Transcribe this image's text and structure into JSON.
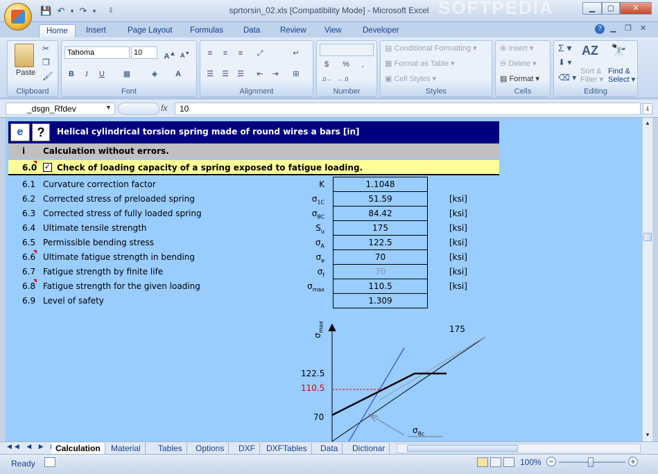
{
  "window": {
    "title": "sprtorsin_02.xls  [Compatibility Mode] - Microsoft Excel",
    "watermark": "SOFTPEDIA"
  },
  "tabs": [
    "Home",
    "Insert",
    "Page Layout",
    "Formulas",
    "Data",
    "Review",
    "View",
    "Developer"
  ],
  "ribbon": {
    "clipboard": {
      "label": "Clipboard",
      "paste": "Paste"
    },
    "font": {
      "label": "Font",
      "name": "Tahoma",
      "size": "10",
      "bold": "B",
      "italic": "I",
      "underline": "U"
    },
    "alignment": {
      "label": "Alignment"
    },
    "number": {
      "label": "Number",
      "currency": "$",
      "percent": "%",
      "comma": ","
    },
    "styles": {
      "label": "Styles",
      "conditional": "Conditional Formatting",
      "format_table": "Format as Table",
      "cell_styles": "Cell Styles"
    },
    "cells": {
      "label": "Cells",
      "insert": "Insert",
      "delete": "Delete",
      "format": "Format"
    },
    "editing": {
      "label": "Editing",
      "sort": "Sort &",
      "filter": "Filter",
      "find": "Find &",
      "select": "Select"
    }
  },
  "formula_bar": {
    "name_box": "_dsgn_Rfdev",
    "fx": "fx",
    "value": "10"
  },
  "sheet": {
    "header_title": "Helical cylindrical torsion spring made of round wires a bars [in]",
    "status_label": "i",
    "status_text": "Calculation without errors.",
    "section_number": "6.0",
    "section_title": "Check of loading capacity of a spring exposed to fatigue loading.",
    "rows": [
      {
        "num": "6.1",
        "label": "Curvature correction factor",
        "sym": "K",
        "sub": "",
        "value": "1.1048",
        "unit": "",
        "grey": false
      },
      {
        "num": "6.2",
        "label": "Corrected stress of preloaded spring",
        "sym": "σ",
        "sub": "1C",
        "value": "51.59",
        "unit": "[ksi]",
        "grey": false
      },
      {
        "num": "6.3",
        "label": "Corrected stress of fully loaded spring",
        "sym": "σ",
        "sub": "8C",
        "value": "84.42",
        "unit": "[ksi]",
        "grey": false
      },
      {
        "num": "6.4",
        "label": "Ultimate tensile strength",
        "sym": "S",
        "sub": "u",
        "value": "175",
        "unit": "[ksi]",
        "grey": false
      },
      {
        "num": "6.5",
        "label": "Permissible bending stress",
        "sym": "σ",
        "sub": "A",
        "value": "122.5",
        "unit": "[ksi]",
        "grey": false
      },
      {
        "num": "6.6",
        "label": "Ultimate fatigue strength in bending",
        "sym": "σ",
        "sub": "e",
        "value": "70",
        "unit": "[ksi]",
        "grey": false
      },
      {
        "num": "6.7",
        "label": "Fatigue strength by finite life",
        "sym": "σ",
        "sub": "f",
        "value": "70",
        "unit": "[ksi]",
        "grey": true
      },
      {
        "num": "6.8",
        "label": "Fatigue strength for the given loading",
        "sym": "σ",
        "sub": "max",
        "value": "110.5",
        "unit": "[ksi]",
        "grey": false
      },
      {
        "num": "6.9",
        "label": "Level of safety",
        "sym": "",
        "sub": "",
        "value": "1.309",
        "unit": "",
        "grey": false
      }
    ],
    "chart": {
      "y_axis_sym": "σ",
      "y_axis_sub": "max",
      "top_label": "175",
      "label_122": "122.5",
      "label_110": "110.5",
      "label_70": "70",
      "arrow_sym": "σ",
      "arrow_sub": "8c"
    }
  },
  "sheet_tabs": [
    "Calculation",
    "Material",
    "Tables",
    "Options",
    "DXF",
    "DXFTables",
    "Data",
    "Dictionar"
  ],
  "status": {
    "ready": "Ready",
    "zoom": "100%"
  }
}
